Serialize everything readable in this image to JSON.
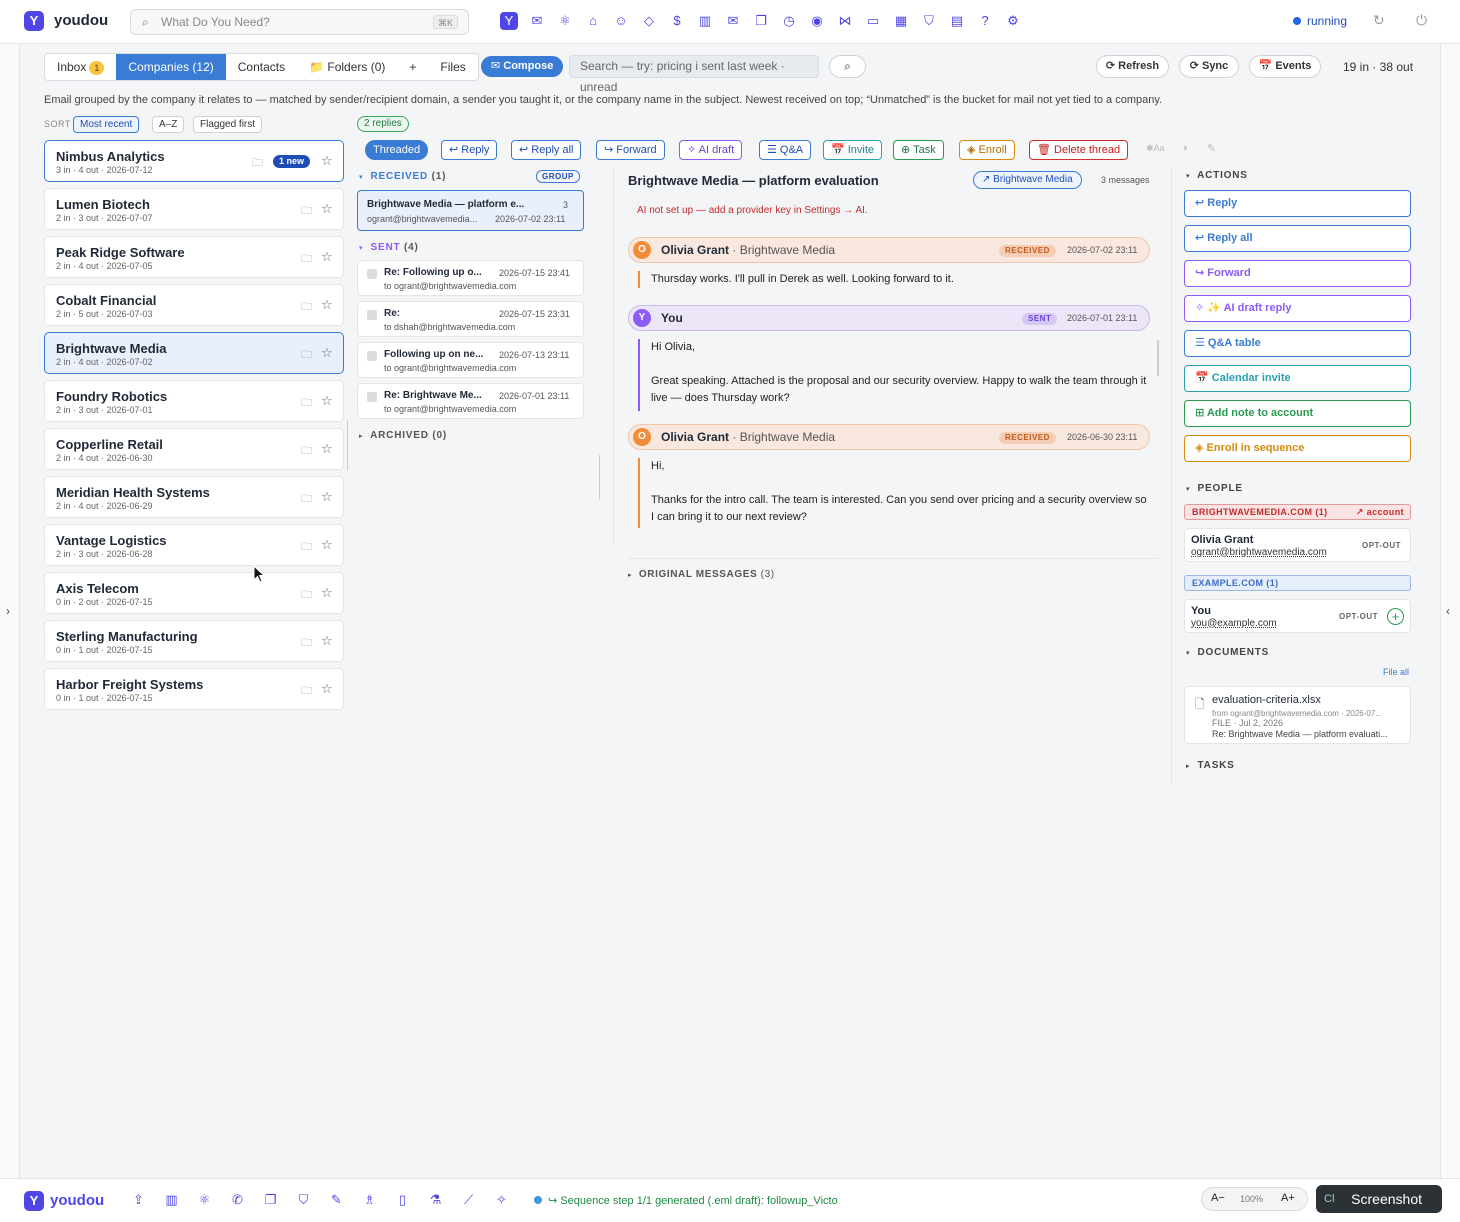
{
  "app": {
    "logo": "Y",
    "name": "youdou",
    "search_placeholder": "What Do You Need?",
    "search_kbd": "⌘K",
    "status": "running"
  },
  "top_icons": [
    "logo-icon",
    "inbox-icon",
    "atom-icon",
    "bank-icon",
    "people-icon",
    "diamond-icon",
    "dollar-icon",
    "chart-icon",
    "mail-icon",
    "copy-icon",
    "clock-icon",
    "eye-icon",
    "share-icon",
    "chat-icon",
    "calendar-icon",
    "shield-icon",
    "clipboard-icon",
    "help-icon",
    "gear-icon"
  ],
  "tabs": [
    {
      "label": "Inbox",
      "badge": "1"
    },
    {
      "label": "Companies (12)"
    },
    {
      "label": "Contacts"
    },
    {
      "label": "📁 Folders (0)"
    },
    {
      "label": "+"
    },
    {
      "label": "Files"
    }
  ],
  "compose_label": "✉ Compose",
  "query_placeholder": "Search — try: pricing i sent last week · unread",
  "toolbar": {
    "refresh": "⟳ Refresh",
    "sync": "⟳ Sync",
    "events": "📅 Events",
    "counts": "19 in · 38 out"
  },
  "description": "Email grouped by the company it relates to — matched by sender/recipient domain, a sender you taught it, or the company name in the subject. Newest received on top; “Unmatched” is the bucket for mail not yet tied to a company.",
  "sort": {
    "label": "SORT",
    "options": [
      "Most recent",
      "A–Z",
      "Flagged first"
    ]
  },
  "companies": [
    {
      "name": "Nimbus Analytics",
      "meta": "3 in · 4 out · 2026-07-12",
      "new": "1 new"
    },
    {
      "name": "Lumen Biotech",
      "meta": "2 in · 3 out · 2026-07-07"
    },
    {
      "name": "Peak Ridge Software",
      "meta": "2 in · 4 out · 2026-07-05"
    },
    {
      "name": "Cobalt Financial",
      "meta": "2 in · 5 out · 2026-07-03"
    },
    {
      "name": "Brightwave Media",
      "meta": "2 in · 4 out · 2026-07-02"
    },
    {
      "name": "Foundry Robotics",
      "meta": "2 in · 3 out · 2026-07-01"
    },
    {
      "name": "Copperline Retail",
      "meta": "2 in · 4 out · 2026-06-30"
    },
    {
      "name": "Meridian Health Systems",
      "meta": "2 in · 4 out · 2026-06-29"
    },
    {
      "name": "Vantage Logistics",
      "meta": "2 in · 3 out · 2026-06-28"
    },
    {
      "name": "Axis Telecom",
      "meta": "0 in · 2 out · 2026-07-15"
    },
    {
      "name": "Sterling Manufacturing",
      "meta": "0 in · 1 out · 2026-07-15"
    },
    {
      "name": "Harbor Freight Systems",
      "meta": "0 in · 1 out · 2026-07-15"
    }
  ],
  "replies_badge": "2 replies",
  "actions_bar": [
    "Threaded",
    "↩ Reply",
    "↩ Reply all",
    "↪ Forward",
    "✧ AI draft",
    "☰ Q&A",
    "📅 Invite",
    "⊕ Task",
    "◈ Enroll",
    "🗑 Delete thread"
  ],
  "received": {
    "label": "RECEIVED",
    "count": "(1)",
    "group": "GROUP",
    "thread": {
      "subject": "Brightwave Media — platform e...",
      "count": "3",
      "from": "ogrant@brightwavemedia...",
      "date": "2026-07-02 23:11"
    }
  },
  "sent": {
    "label": "SENT",
    "count": "(4)",
    "threads": [
      {
        "subject": "Re: Following up o...",
        "date": "2026-07-15 23:41",
        "to": "to ogrant@brightwavemedia.com"
      },
      {
        "subject": "Re:",
        "date": "2026-07-15 23:31",
        "to": "to dshah@brightwavemedia.com"
      },
      {
        "subject": "Following up on ne...",
        "date": "2026-07-13 23:11",
        "to": "to ogrant@brightwavemedia.com"
      },
      {
        "subject": "Re: Brightwave Me...",
        "date": "2026-07-01 23:11",
        "to": "to ogrant@brightwavemedia.com"
      }
    ]
  },
  "archived": {
    "label": "ARCHIVED",
    "count": "(0)"
  },
  "reader": {
    "title": "Brightwave Media — platform evaluation",
    "company_tag": "↗ Brightwave Media",
    "msg_count": "3 messages",
    "ai_warning": "AI not set up — add a provider key in Settings → AI.",
    "messages": [
      {
        "avatar": "O",
        "name": "Olivia Grant",
        "company": " · Brightwave Media",
        "tag": "RECEIVED",
        "date": "2026-07-02 23:11",
        "body": [
          "Thursday works. I'll pull in Derek as well. Looking forward to it."
        ]
      },
      {
        "avatar": "Y",
        "name": "You",
        "company": "",
        "tag": "SENT",
        "date": "2026-07-01 23:11",
        "body": [
          "Hi Olivia,",
          "Great speaking. Attached is the proposal and our security overview. Happy to walk the team through it live — does Thursday work?"
        ]
      },
      {
        "avatar": "O",
        "name": "Olivia Grant",
        "company": " · Brightwave Media",
        "tag": "RECEIVED",
        "date": "2026-06-30 23:11",
        "body": [
          "Hi,",
          "Thanks for the intro call. The team is interested. Can you send over pricing and a security overview so I can bring it to our next review?"
        ]
      }
    ],
    "original": "ORIGINAL MESSAGES",
    "original_count": "(3)"
  },
  "right": {
    "actions_label": "ACTIONS",
    "actions": [
      {
        "label": "↩  Reply",
        "color": "#3a7bd5"
      },
      {
        "label": "↩  Reply all",
        "color": "#3a7bd5"
      },
      {
        "label": "↪  Forward",
        "color": "#8b5cf6"
      },
      {
        "label": "✧  ✨ AI draft reply",
        "color": "#8b5cf6"
      },
      {
        "label": "☰  Q&A table",
        "color": "#3a7bd5"
      },
      {
        "label": "📅  Calendar invite",
        "color": "#2a9fb0"
      },
      {
        "label": "⊞  Add note to account",
        "color": "#2a9a50"
      },
      {
        "label": "◈  Enroll in sequence",
        "color": "#d98a10"
      }
    ],
    "people_label": "PEOPLE",
    "domain1": {
      "label": "BRIGHTWAVEMEDIA.COM (1)",
      "link": "↗ account"
    },
    "person1": {
      "name": "Olivia Grant",
      "email": "ogrant@brightwavemedia.com",
      "opt": "OPT-OUT"
    },
    "domain2": {
      "label": "EXAMPLE.COM (1)"
    },
    "person2": {
      "name": "You",
      "email": "you@example.com",
      "opt": "OPT-OUT"
    },
    "documents_label": "DOCUMENTS",
    "file_all": "File all",
    "doc": {
      "name": "evaluation-criteria.xlsx",
      "from": "from ogrant@brightwavemedia.com · 2026-07...",
      "type": "FILE · Jul 2, 2026",
      "subject": "Re: Brightwave Media — platform evaluati..."
    },
    "tasks_label": "TASKS"
  },
  "bottom": {
    "logo": "Y",
    "name": "youdou",
    "status": "↪ Sequence step 1/1 generated (.eml draft): followup_Victo",
    "zoom_out": "A−",
    "zoom": "100%",
    "zoom_in": "A+",
    "screenshot": "Screenshot",
    "cl": "Cl"
  }
}
